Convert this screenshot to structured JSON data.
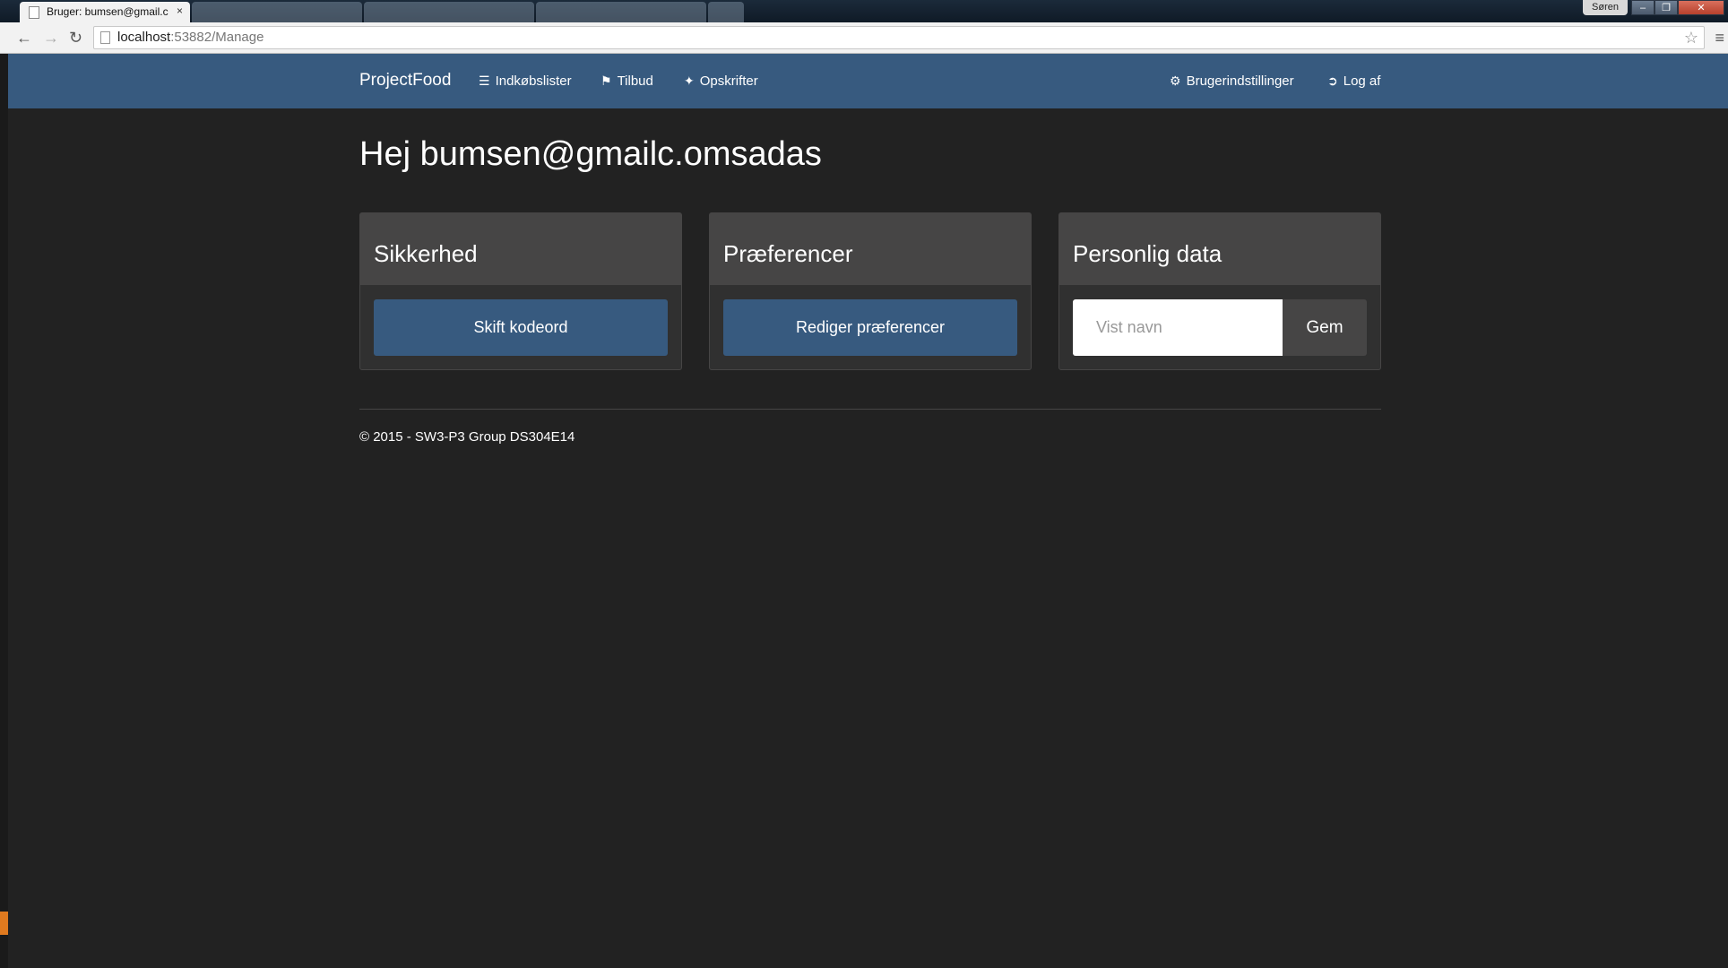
{
  "browser": {
    "active_tab_title": "Bruger: bumsen@gmail.c",
    "tab_close": "×",
    "url_host": "localhost",
    "url_rest": ":53882/Manage",
    "window_user": "Søren",
    "icons": [
      "back-icon",
      "forward-icon",
      "reload-icon",
      "star-icon",
      "menu-icon"
    ]
  },
  "nav": {
    "brand": "ProjectFood",
    "items": [
      {
        "label": "Indkøbslister",
        "icon": "list-icon"
      },
      {
        "label": "Tilbud",
        "icon": "tag-icon"
      },
      {
        "label": "Opskrifter",
        "icon": "cutlery-icon"
      }
    ],
    "right": [
      {
        "label": "Brugerindstillinger",
        "icon": "gear-icon"
      },
      {
        "label": "Log af",
        "icon": "logout-icon"
      }
    ]
  },
  "main": {
    "greeting": "Hej bumsen@gmailc.omsadas",
    "panels": [
      {
        "title": "Sikkerhed",
        "button": "Skift kodeord"
      },
      {
        "title": "Præferencer",
        "button": "Rediger præferencer"
      },
      {
        "title": "Personlig data",
        "input_placeholder": "Vist navn",
        "input_value": "",
        "button": "Gem"
      }
    ]
  },
  "footer": {
    "text": "© 2015 - SW3-P3 Group DS304E14"
  },
  "colors": {
    "navbar": "#375a7f",
    "background": "#222222",
    "panel_heading": "#464545"
  }
}
